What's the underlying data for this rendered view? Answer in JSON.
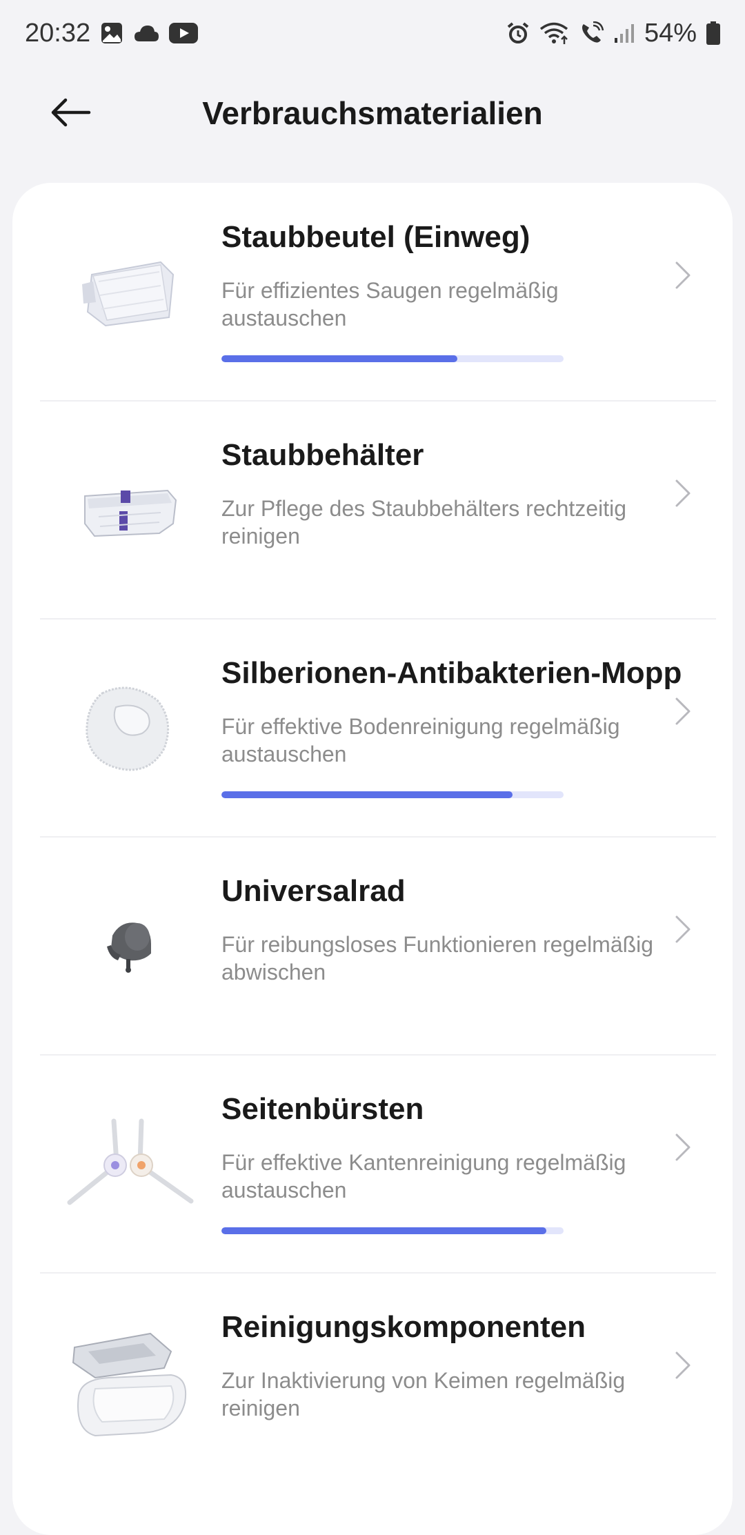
{
  "status_bar": {
    "time": "20:32",
    "battery": "54%",
    "icons_left": [
      "gallery-icon",
      "cloud-icon",
      "youtube-icon"
    ],
    "icons_right": [
      "alarm-icon",
      "wifi-icon",
      "wifi-calling-icon",
      "signal-icon",
      "battery-icon"
    ]
  },
  "header": {
    "title": "Verbrauchsmaterialien",
    "back_icon": "arrow-left-icon"
  },
  "colors": {
    "accent": "#5a6fe8",
    "progress_track": "#e2e5fb",
    "background": "#f3f3f6",
    "card": "#ffffff",
    "title_text": "#1a1a1a",
    "description_text": "#8c8c8c"
  },
  "items": [
    {
      "title": "Staubbeutel (Einweg)",
      "description": "Für effizientes Saugen regelmäßig austauschen",
      "image": "dust-bag-image",
      "progress": 0.69
    },
    {
      "title": "Staubbehälter",
      "description": "Zur Pflege des Staubbehälters rechtzeitig reinigen",
      "image": "dust-bin-image"
    },
    {
      "title": "Silberionen-Antibakterien-Mopp",
      "description": "Für effektive Bodenreinigung regelmäßig austauschen",
      "image": "mop-pad-image",
      "progress": 0.85
    },
    {
      "title": "Universalrad",
      "description": "Für reibungsloses Funktionieren regelmäßig abwischen",
      "image": "universal-wheel-image"
    },
    {
      "title": "Seitenbürsten",
      "description": "Für effektive Kantenreinigung regelmäßig austauschen",
      "image": "side-brushes-image",
      "progress": 0.95
    },
    {
      "title": "Reinigungskomponenten",
      "description": "Zur Inaktivierung von Keimen regelmäßig reinigen",
      "image": "cleaning-components-image"
    }
  ]
}
